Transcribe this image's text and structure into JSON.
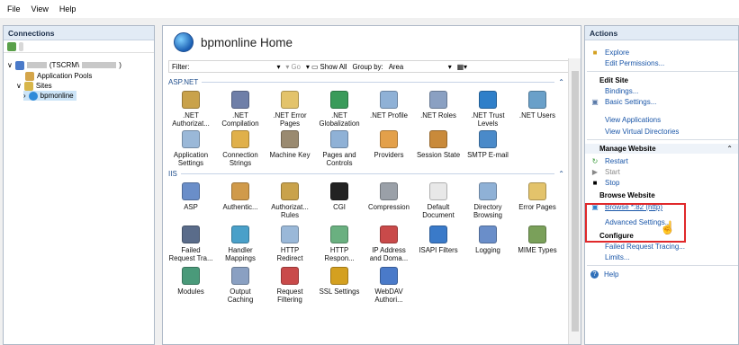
{
  "menu": [
    "File",
    "View",
    "Help"
  ],
  "connections": {
    "header": "Connections",
    "server_label": "(TSCRM\\",
    "server_suffix": ")",
    "app_pools": "Application Pools",
    "sites": "Sites",
    "site": "bpmonline"
  },
  "main": {
    "title": "bpmonline Home",
    "filter_label": "Filter:",
    "go": "Go",
    "show_all": "Show All",
    "group_by": "Group by:",
    "group_value": "Area",
    "sections": [
      "ASP.NET",
      "IIS"
    ],
    "aspnet_row1": [
      {
        "label": ".NET Authorizat...",
        "color": "#c9a24b"
      },
      {
        "label": ".NET Compilation",
        "color": "#6f7fa8"
      },
      {
        "label": ".NET Error Pages",
        "color": "#e3c36b"
      },
      {
        "label": ".NET Globalization",
        "color": "#3a9b5a"
      },
      {
        "label": ".NET Profile",
        "color": "#8fb1d6"
      },
      {
        "label": ".NET Roles",
        "color": "#8aa0c2"
      },
      {
        "label": ".NET Trust Levels",
        "color": "#2f7fc9"
      },
      {
        "label": ".NET Users",
        "color": "#6aa0c9"
      }
    ],
    "aspnet_row2": [
      {
        "label": "Application Settings",
        "color": "#9ab8d8"
      },
      {
        "label": "Connection Strings",
        "color": "#e0b04a"
      },
      {
        "label": "Machine Key",
        "color": "#9a8a70"
      },
      {
        "label": "Pages and Controls",
        "color": "#8fb1d6"
      },
      {
        "label": "Providers",
        "color": "#e3a04a"
      },
      {
        "label": "Session State",
        "color": "#c98a3a"
      },
      {
        "label": "SMTP E-mail",
        "color": "#4a8ac9"
      }
    ],
    "iis_row1": [
      {
        "label": "ASP",
        "color": "#6a8ec9"
      },
      {
        "label": "Authentic...",
        "color": "#d09a4a"
      },
      {
        "label": "Authorizat... Rules",
        "color": "#c9a24b"
      },
      {
        "label": "CGI",
        "color": "#222222"
      },
      {
        "label": "Compression",
        "color": "#9aa0a8"
      },
      {
        "label": "Default Document",
        "color": "#e8e8e8"
      },
      {
        "label": "Directory Browsing",
        "color": "#8fb1d6"
      },
      {
        "label": "Error Pages",
        "color": "#e3c36b"
      }
    ],
    "iis_row2": [
      {
        "label": "Failed Request Tra...",
        "color": "#5a6c8a"
      },
      {
        "label": "Handler Mappings",
        "color": "#4aa0c9"
      },
      {
        "label": "HTTP Redirect",
        "color": "#9ab8d8"
      },
      {
        "label": "HTTP Respon...",
        "color": "#6ab080"
      },
      {
        "label": "IP Address and Doma...",
        "color": "#c94a4a"
      },
      {
        "label": "ISAPI Filters",
        "color": "#3a7ac9"
      },
      {
        "label": "Logging",
        "color": "#6a8ec9"
      },
      {
        "label": "MIME Types",
        "color": "#7aa05a"
      }
    ],
    "iis_row3": [
      {
        "label": "Modules",
        "color": "#4a9a7a"
      },
      {
        "label": "Output Caching",
        "color": "#8aa0c2"
      },
      {
        "label": "Request Filtering",
        "color": "#c94a4a"
      },
      {
        "label": "SSL Settings",
        "color": "#d4a020"
      },
      {
        "label": "WebDAV Authori...",
        "color": "#4a7ac9"
      }
    ]
  },
  "actions": {
    "header": "Actions",
    "explore": "Explore",
    "edit_permissions": "Edit Permissions...",
    "edit_site": "Edit Site",
    "bindings": "Bindings...",
    "basic_settings": "Basic Settings...",
    "view_applications": "View Applications",
    "view_virtual_dirs": "View Virtual Directories",
    "manage_website": "Manage Website",
    "restart": "Restart",
    "start": "Start",
    "stop": "Stop",
    "browse_website": "Browse Website",
    "browse_82": "Browse *:82 (http)",
    "advanced_settings": "Advanced Settings...",
    "configure": "Configure",
    "failed_request_tracing": "Failed Request Tracing...",
    "limits": "Limits...",
    "help": "Help"
  },
  "colors": {
    "link": "#1a56a8",
    "highlight": "#e0292b",
    "section": "#1f4e8c"
  }
}
